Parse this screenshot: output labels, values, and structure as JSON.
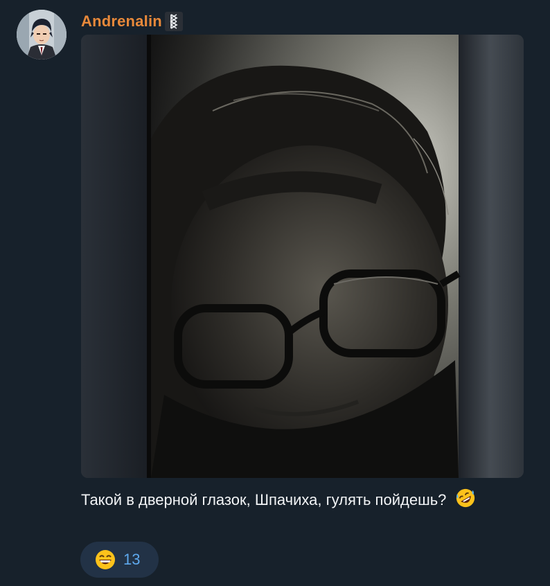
{
  "message": {
    "sender": {
      "name": "Andrenalin",
      "badge_icon": "bjarkan-rune-icon",
      "name_color": "#e8893a"
    },
    "media": {
      "type": "photo",
      "description_icon": "photo-media"
    },
    "caption": {
      "text": "Такой в дверной глазок, Шпачиха, гулять пойдешь?",
      "emoji_icon": "rolling-on-floor-laughing-emoji"
    },
    "reactions": [
      {
        "emoji_icon": "grinning-face-emoji",
        "count": "13"
      }
    ]
  },
  "colors": {
    "background": "#17212b",
    "reaction_bg": "#223246",
    "reaction_count": "#5ea9ee",
    "text": "#f2f4f6"
  }
}
